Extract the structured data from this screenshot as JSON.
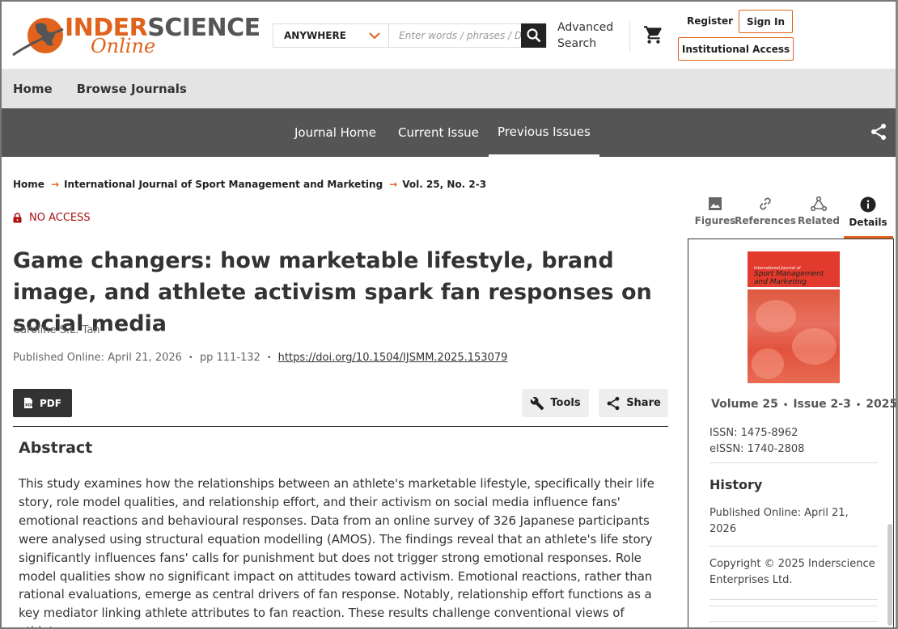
{
  "header": {
    "logo_inder": "INDER",
    "logo_science": "SCIENCE",
    "logo_online": "Online",
    "search_scope": "ANYWHERE",
    "search_placeholder": "Enter words / phrases / DOI / ISBN / authors / keywords / etc.",
    "advanced_search_line1": "Advanced",
    "advanced_search_line2": "Search",
    "register": "Register",
    "sign_in": "Sign In",
    "institutional_access": "Institutional Access"
  },
  "main_nav": {
    "items": [
      "Home",
      "Browse Journals"
    ]
  },
  "journal_nav": {
    "items": [
      "Journal Home",
      "Current Issue",
      "Previous Issues"
    ],
    "active": "Previous Issues"
  },
  "breadcrumb": {
    "items": [
      "Home",
      "International Journal of Sport Management and Marketing",
      "Vol. 25, No. 2-3"
    ]
  },
  "article": {
    "access": "NO ACCESS",
    "title": "Game changers: how marketable lifestyle, brand image, and athlete activism spark fan responses on social media",
    "author": "Caroline S.L. Tan",
    "published": "Published Online: April 21, 2026",
    "pages": "pp 111-132",
    "doi": "https://doi.org/10.1504/IJSMM.2025.153079",
    "pdf_label": "PDF",
    "tools_label": "Tools",
    "share_label": "Share",
    "abstract_heading": "Abstract",
    "abstract": "This study examines how the relationships between an athlete's marketable lifestyle, specifically their life story, role model qualities, and relationship effort, and their activism on social media influence fans' emotional reactions and behavioural responses. Data from an online survey of 326 Japanese participants were analysed using structural equation modelling (AMOS). The findings reveal that an athlete's life story significantly influences fans' calls for punishment but does not trigger strong emotional responses. Role model qualities show no significant impact on attitudes toward activism. Emotional reactions, rather than rational evaluations, emerge as central drivers of fan response. Notably, relationship effort functions as a key mediator linking athlete attributes to fan reaction. These results challenge conventional views of athlete-"
  },
  "side_tabs": {
    "items": [
      "Figures",
      "References",
      "Related",
      "Details"
    ],
    "active": "Details"
  },
  "details": {
    "cover_small": "International Journal of",
    "cover_title": "Sport Management and Marketing",
    "volume": "Volume 25",
    "issue": "Issue 2-3",
    "year": "2025",
    "issn": "ISSN: 1475-8962",
    "eissn": "eISSN: 1740-2808",
    "history_heading": "History",
    "history_published": "Published Online: April 21, 2026",
    "copyright": "Copyright © 2025 Inderscience Enterprises Ltd."
  },
  "colors": {
    "accent": "#e0621c",
    "nav_dark": "#555555",
    "nav_light": "#e4e4e4",
    "no_access": "#aa1111"
  }
}
